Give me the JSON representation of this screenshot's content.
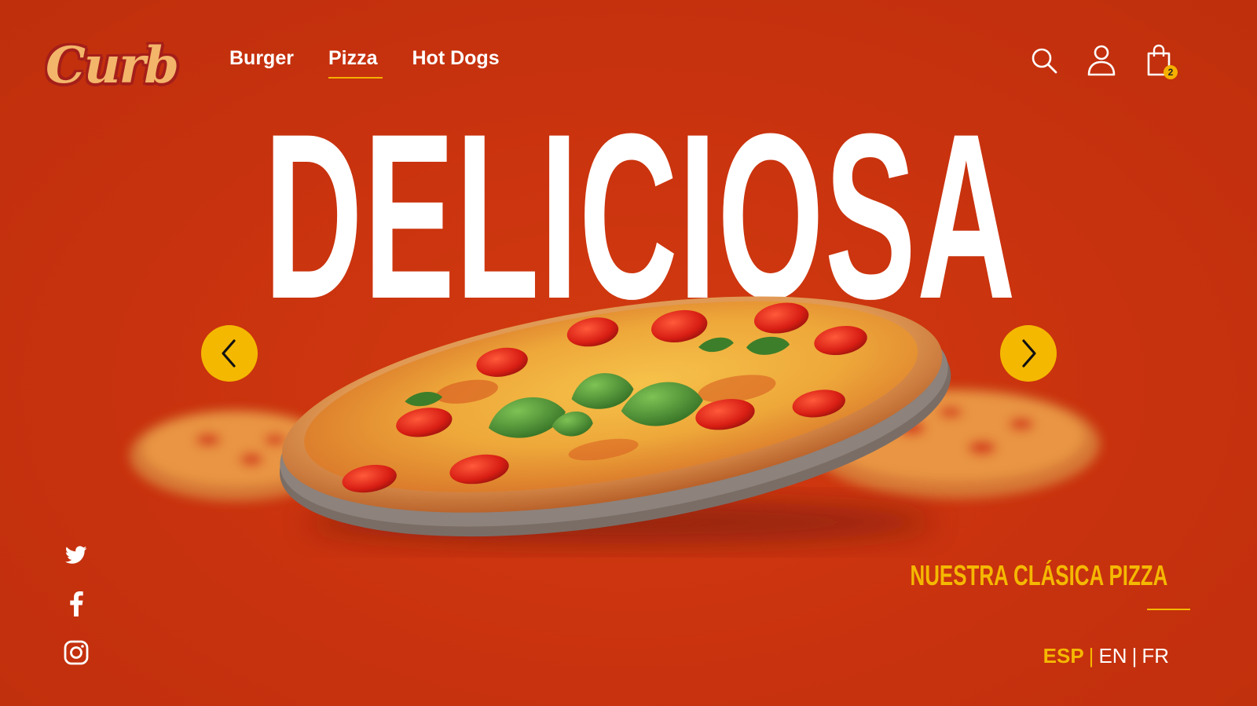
{
  "brand": {
    "logo_text": "Curb"
  },
  "nav": {
    "items": [
      {
        "label": "Burger",
        "active": false
      },
      {
        "label": "Pizza",
        "active": true
      },
      {
        "label": "Hot Dogs",
        "active": false
      }
    ]
  },
  "header_icons": {
    "search": "search-icon",
    "account": "user-icon",
    "cart": "shopping-bag-icon",
    "cart_count": "2"
  },
  "hero": {
    "title": "DELICIOSA",
    "image": "pizza-image",
    "prev": "chevron-left-icon",
    "next": "chevron-right-icon"
  },
  "social": [
    "twitter-icon",
    "facebook-icon",
    "instagram-icon"
  ],
  "tagline": "NUESTRA CLÁSICA PIZZA",
  "languages": {
    "active": "ESP",
    "options": [
      "ESP",
      "EN",
      "FR"
    ],
    "separator": "|"
  },
  "colors": {
    "background": "#c8320e",
    "accent": "#f5b800",
    "text": "#ffffff"
  }
}
